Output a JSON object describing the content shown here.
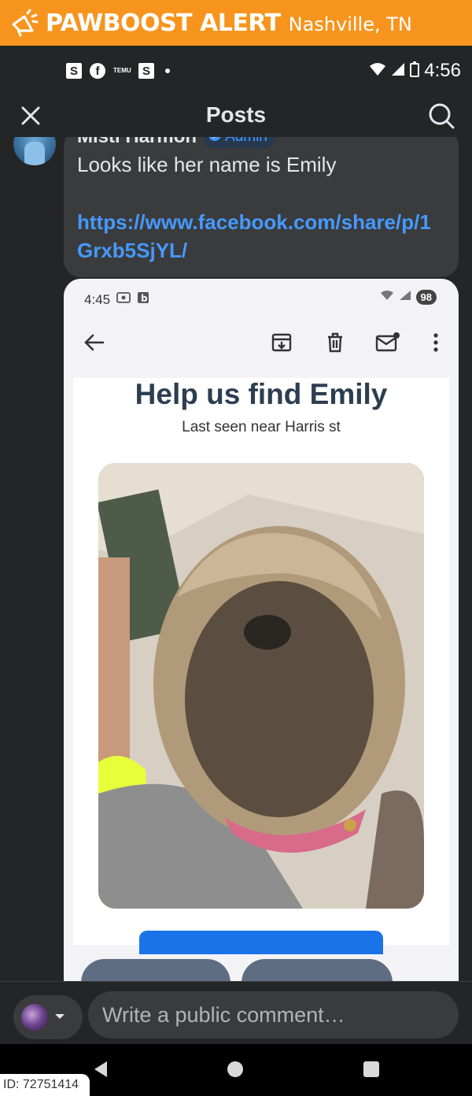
{
  "banner": {
    "brand": "PAWBOOST ALERT",
    "location": "Nashville, TN",
    "icon": "megaphone-icon",
    "color": "#f7941d"
  },
  "status_bar": {
    "left_icons": [
      "S",
      "f",
      "TEMU",
      "S"
    ],
    "time": "4:56"
  },
  "header": {
    "title": "Posts",
    "close_icon": "close-icon",
    "search_icon": "search-icon"
  },
  "comment": {
    "author": "Misti Harmon",
    "badge": "Admin",
    "text": "Looks like her name is Emily",
    "link": "https://www.facebook.com/share/p/1Grxb5SjYL/"
  },
  "attachment": {
    "status_time": "4:45",
    "battery": "98",
    "flyer_title": "Help us find Emily",
    "flyer_subtitle": "Last seen near Harris st"
  },
  "composer": {
    "placeholder": "Write a public comment…"
  },
  "watermark": {
    "id": "ID: 72751414"
  },
  "colors": {
    "background": "#242526",
    "bubble": "#3a3b3c",
    "link": "#4599ff",
    "flyer_title": "#2c3e4f",
    "flyer_button": "#1a73e8"
  }
}
